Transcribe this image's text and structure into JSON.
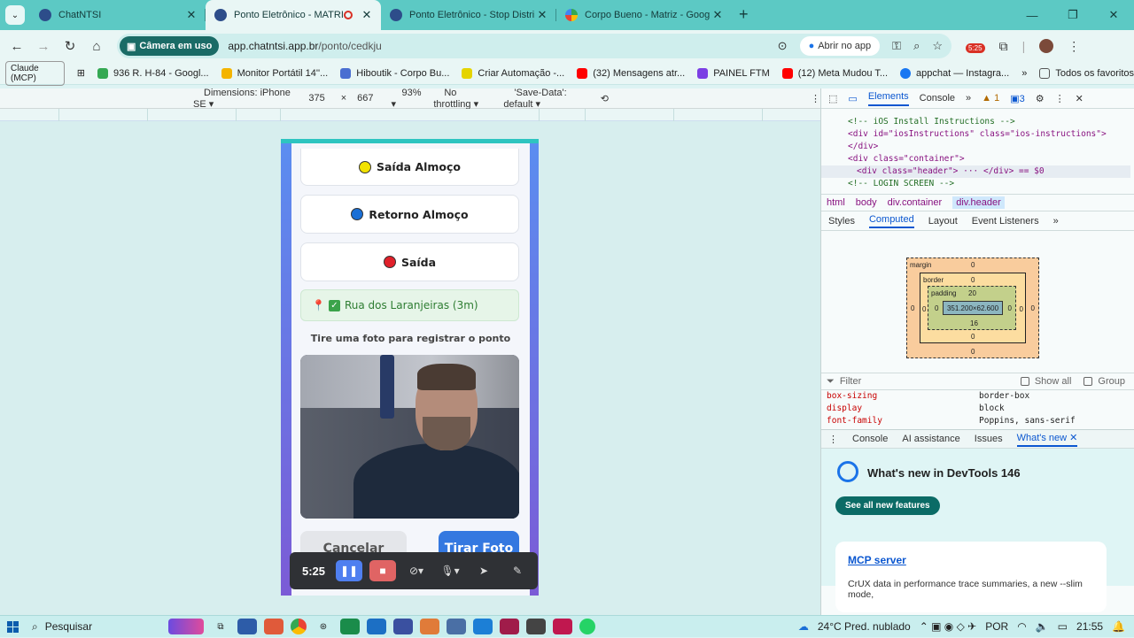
{
  "browser": {
    "tabs": [
      {
        "title": "ChatNTSI",
        "active": false
      },
      {
        "title": "Ponto Eletrônico - MATRIZ",
        "active": true,
        "recording": true
      },
      {
        "title": "Ponto Eletrônico - Stop Distribu",
        "active": false
      },
      {
        "title": "Corpo Bueno - Matriz - Google",
        "active": false
      }
    ],
    "camera_pill": "Câmera em uso",
    "url_host": "app.chatntsi.app.br",
    "url_path": "/ponto/cedkju",
    "open_app": "Abrir no app",
    "ext_badge": "5:25",
    "bookmarks": [
      {
        "label": "Claude (MCP)"
      },
      {
        "label": "936 R. H-84 - Googl...",
        "color": "#34a853"
      },
      {
        "label": "Monitor Portátil 14''...",
        "color": "#f4b400"
      },
      {
        "label": "Hiboutik - Corpo Bu...",
        "color": "#4a6fd1"
      },
      {
        "label": "Criar Automação -...",
        "color": "#222"
      },
      {
        "label": "(32) Mensagens atr...",
        "color": "#ff0000"
      },
      {
        "label": "PAINEL FTM",
        "color": "#7b3fe4"
      },
      {
        "label": "(12) Meta Mudou T...",
        "color": "#ff0000"
      },
      {
        "label": "appchat — Instagra...",
        "color": "#1877f2"
      }
    ],
    "all_bookmarks": "Todos os favoritos"
  },
  "device_bar": {
    "dimensions": "Dimensions: iPhone SE",
    "width": "375",
    "height": "667",
    "zoom": "93%",
    "throttle": "No throttling",
    "save_data": "'Save-Data': default"
  },
  "app": {
    "buttons": [
      {
        "label": "Saída Almoço",
        "color": "#f2e200"
      },
      {
        "label": "Retorno Almoço",
        "color": "#1a6fd6"
      },
      {
        "label": "Saída",
        "color": "#e0202a"
      }
    ],
    "location": "Rua dos Laranjeiras (3m)",
    "photo_hint": "Tire uma foto para registrar o ponto",
    "cancel": "Cancelar",
    "take_photo": "Tirar Foto"
  },
  "recorder": {
    "time": "5:25"
  },
  "devtools": {
    "tabs": [
      "Elements",
      "Console"
    ],
    "warnings": "1",
    "issues": "3",
    "code": [
      "<!-- iOS Install Instructions -->",
      "<div id=\"iosInstructions\" class=\"ios-instructions\">",
      "</div>",
      "<div class=\"container\">",
      "<div class=\"header\"> ··· </div> == $0",
      "<!-- LOGIN SCREEN -->"
    ],
    "crumbs": [
      "html",
      "body",
      "div.container",
      "div.header"
    ],
    "subtabs": [
      "Styles",
      "Computed",
      "Layout",
      "Event Listeners"
    ],
    "box": {
      "margin_label": "margin",
      "border_label": "border",
      "padding_label": "padding",
      "margin_top": "0",
      "margin_bottom": "0",
      "margin_left": "0",
      "margin_right": "0",
      "border_top": "0",
      "border_bottom": "0",
      "border_left": "0",
      "border_right": "0",
      "padding_top": "20",
      "padding_bottom": "16",
      "padding_left": "0",
      "padding_right": "0",
      "content": "351.200×62.600"
    },
    "filter": "Filter",
    "show_all": "Show all",
    "group": "Group",
    "props": [
      {
        "k": "box-sizing",
        "v": "border-box"
      },
      {
        "k": "display",
        "v": "block"
      },
      {
        "k": "font-family",
        "v": "Poppins, sans-serif"
      }
    ],
    "drawer_tabs": [
      "Console",
      "AI assistance",
      "Issues",
      "What's new"
    ],
    "whats_new_title": "What's new in DevTools 146",
    "see_all": "See all new features",
    "card_title": "MCP server",
    "card_text": "CrUX data in performance trace summaries, a new --slim mode,"
  },
  "taskbar": {
    "search": "Pesquisar",
    "weather": "24°C  Pred. nublado",
    "lang": "POR",
    "time": "21:55"
  }
}
